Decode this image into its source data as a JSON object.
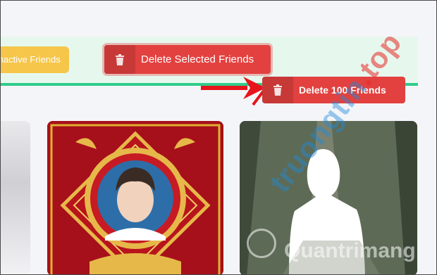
{
  "toolbar": {
    "inactive_button_label": "Inactive Friends",
    "delete_selected_label": "Delete Selected Friends",
    "delete_100_label": "Delete 100 Friends"
  },
  "watermark": {
    "text_main": "truongtin",
    "text_accent": ".top",
    "text_sub": "Quantrimang"
  },
  "colors": {
    "toolbar_bg": "#e6f8ee",
    "toolbar_border": "#2ecc8a",
    "inactive_button": "#f6c64a",
    "delete_button": "#e2413f",
    "arrow": "#e8141b"
  },
  "icons": [
    "trash-icon",
    "red-arrow-icon"
  ]
}
